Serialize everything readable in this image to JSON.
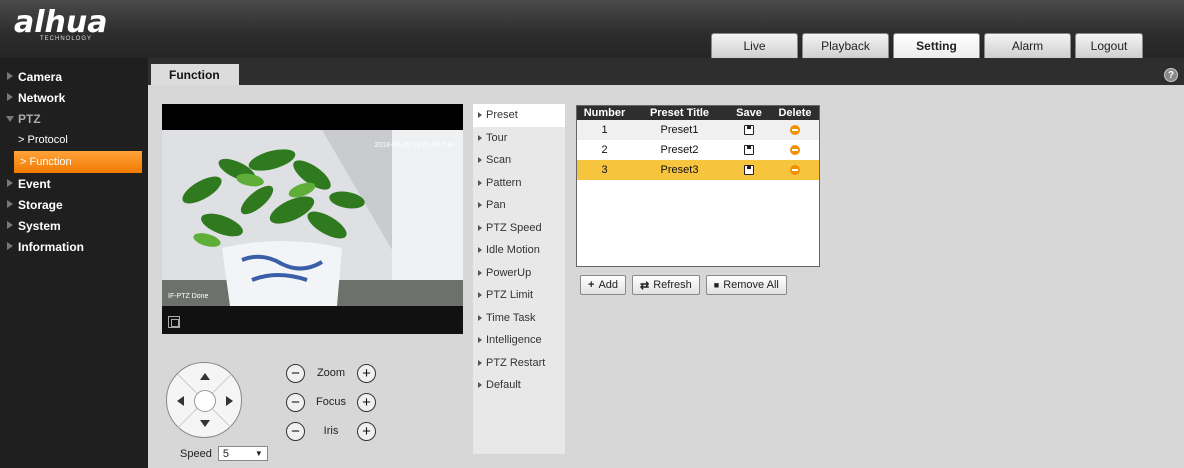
{
  "header": {
    "brand": "alhua",
    "tagline": "TECHNOLOGY",
    "tabs": [
      {
        "label": "Live"
      },
      {
        "label": "Playback"
      },
      {
        "label": "Setting",
        "active": true
      },
      {
        "label": "Alarm"
      },
      {
        "label": "Logout"
      }
    ]
  },
  "sidebar": {
    "camera": "Camera",
    "network": "Network",
    "ptz": "PTZ",
    "protocol": "> Protocol",
    "function": "> Function",
    "event": "Event",
    "storage": "Storage",
    "system": "System",
    "information": "Information"
  },
  "page": {
    "tab": "Function",
    "help_icon": "?"
  },
  "video": {
    "osd_time": "2018-06-26 09:25:09 Tue",
    "osd_status": "IF-PTZ Done"
  },
  "ptz": {
    "zoom": "Zoom",
    "focus": "Focus",
    "iris": "Iris",
    "minus": "−",
    "plus": "+",
    "speed_label": "Speed",
    "speed_value": "5",
    "speed_caret": "▼"
  },
  "functions": {
    "preset": "Preset",
    "tour": "Tour",
    "scan": "Scan",
    "pattern": "Pattern",
    "pan": "Pan",
    "ptz_speed": "PTZ Speed",
    "idle_motion": "Idle Motion",
    "powerup": "PowerUp",
    "ptz_limit": "PTZ Limit",
    "time_task": "Time Task",
    "intelligence": "Intelligence",
    "ptz_restart": "PTZ Restart",
    "default": "Default"
  },
  "preset_table": {
    "headers": {
      "number": "Number",
      "title": "Preset Title",
      "save": "Save",
      "delete": "Delete"
    },
    "rows": [
      {
        "number": "1",
        "title": "Preset1"
      },
      {
        "number": "2",
        "title": "Preset2"
      },
      {
        "number": "3",
        "title": "Preset3",
        "selected": true
      }
    ]
  },
  "buttons": {
    "add": "Add",
    "add_icon": "+",
    "refresh": "Refresh",
    "refresh_icon": "⇄",
    "remove_all": "Remove All",
    "remove_icon": "■"
  }
}
